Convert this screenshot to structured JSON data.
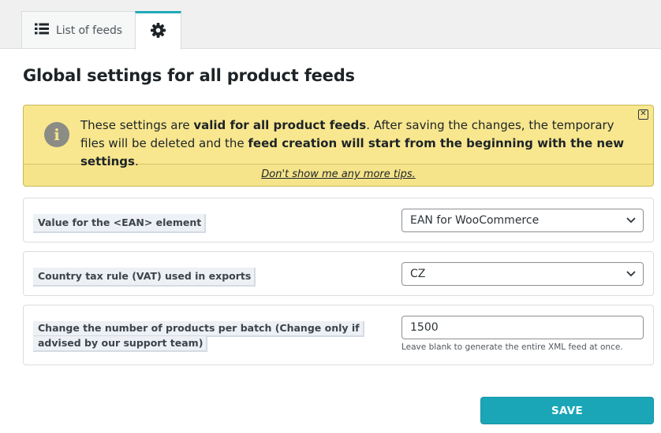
{
  "tabs": {
    "list_of_feeds": {
      "label": "List of feeds",
      "icon": "list-icon"
    },
    "settings": {
      "icon": "gear-icon",
      "active": true
    }
  },
  "page": {
    "title": "Global settings for all product feeds"
  },
  "notice": {
    "icon": "info-icon",
    "text_parts": [
      "These settings are ",
      "valid for all product feeds",
      ". After saving the changes, the temporary files will be deleted and the ",
      "feed creation will start from the beginning with the new settings",
      "."
    ],
    "dismiss_link": "Don't show me any more tips.",
    "background_color": "#f8e78f"
  },
  "settings": {
    "ean": {
      "label": "Value for the <EAN> element",
      "value": "EAN for WooCommerce"
    },
    "vat": {
      "label": "Country tax rule (VAT) used in exports",
      "value": "CZ"
    },
    "batch": {
      "label": "Change the number of products per batch (Change only if advised by our support team)",
      "value": "1500",
      "hint": "Leave blank to generate the entire XML feed at once."
    }
  },
  "save": {
    "label": "SAVE",
    "color": "#1aa6b7"
  },
  "colors": {
    "accent": "#22a9b8"
  }
}
